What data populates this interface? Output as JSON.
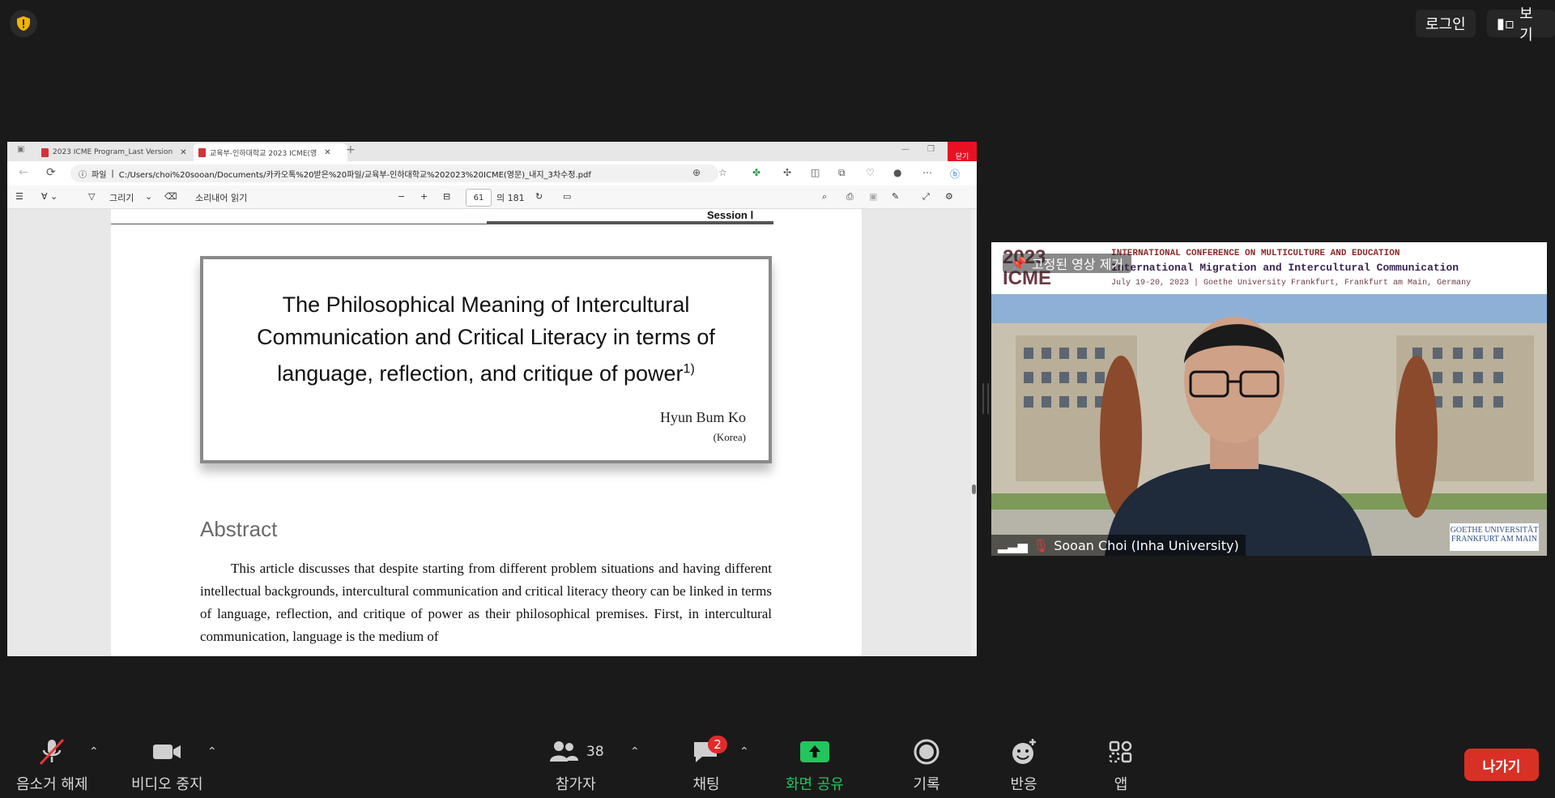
{
  "top": {
    "login": "로그인",
    "view": "보기"
  },
  "browser": {
    "tabs": [
      {
        "title": "2023 ICME Program_Last Version"
      },
      {
        "title": "교육부-인하대학교 2023 ICME(영"
      }
    ],
    "close_tooltip": "닫기",
    "url_prefix": "파일",
    "url": "C:/Users/choi%20sooan/Documents/카카오톡%20받은%20파일/교육부-인하대학교%202023%20ICME(영문)_내지_3차수정.pdf",
    "pdf_toolbar": {
      "draw": "그리기",
      "read_aloud": "소리내어 읽기",
      "page": "61",
      "page_of": "의 181"
    }
  },
  "document": {
    "session": "Session Ⅰ",
    "title_lines": [
      "The Philosophical Meaning of Intercultural",
      "Communication and Critical Literacy in terms of",
      "language, reflection, and critique of power"
    ],
    "footnote_mark": "1)",
    "author": "Hyun Bum Ko",
    "country": "(Korea)",
    "abstract_heading": "Abstract",
    "abstract_text": "This article discusses that despite starting from different problem situations and having different intellectual backgrounds, intercultural communication and critical literacy theory can be linked in terms of language, reflection, and critique of power as their philosophical premises. First, in intercultural communication, language is the medium of"
  },
  "video": {
    "pinned": "고정된 영상 제거",
    "year": "2023",
    "brand": "ICME",
    "conference_line1": "INTERNATIONAL CONFERENCE ON MULTICULTURE AND EDUCATION",
    "conference_line2": "International Migration and Intercultural Communication",
    "conference_line3": "July 19-20, 2023 | Goethe University Frankfurt, Frankfurt am Main, Germany",
    "participant": "Sooan Choi (Inha University)",
    "university_logo": "GOETHE UNIVERSITÄT FRANKFURT AM MAIN"
  },
  "toolbar": {
    "mute": "음소거 해제",
    "video": "비디오 중지",
    "participants": "참가자",
    "participants_count": "38",
    "chat": "채팅",
    "chat_badge": "2",
    "share": "화면 공유",
    "record": "기록",
    "reactions": "반응",
    "apps": "앱",
    "leave": "나가기"
  },
  "colors": {
    "share_green": "#22c55e",
    "leave_red": "#d93025",
    "badge_red": "#e02b2b"
  }
}
